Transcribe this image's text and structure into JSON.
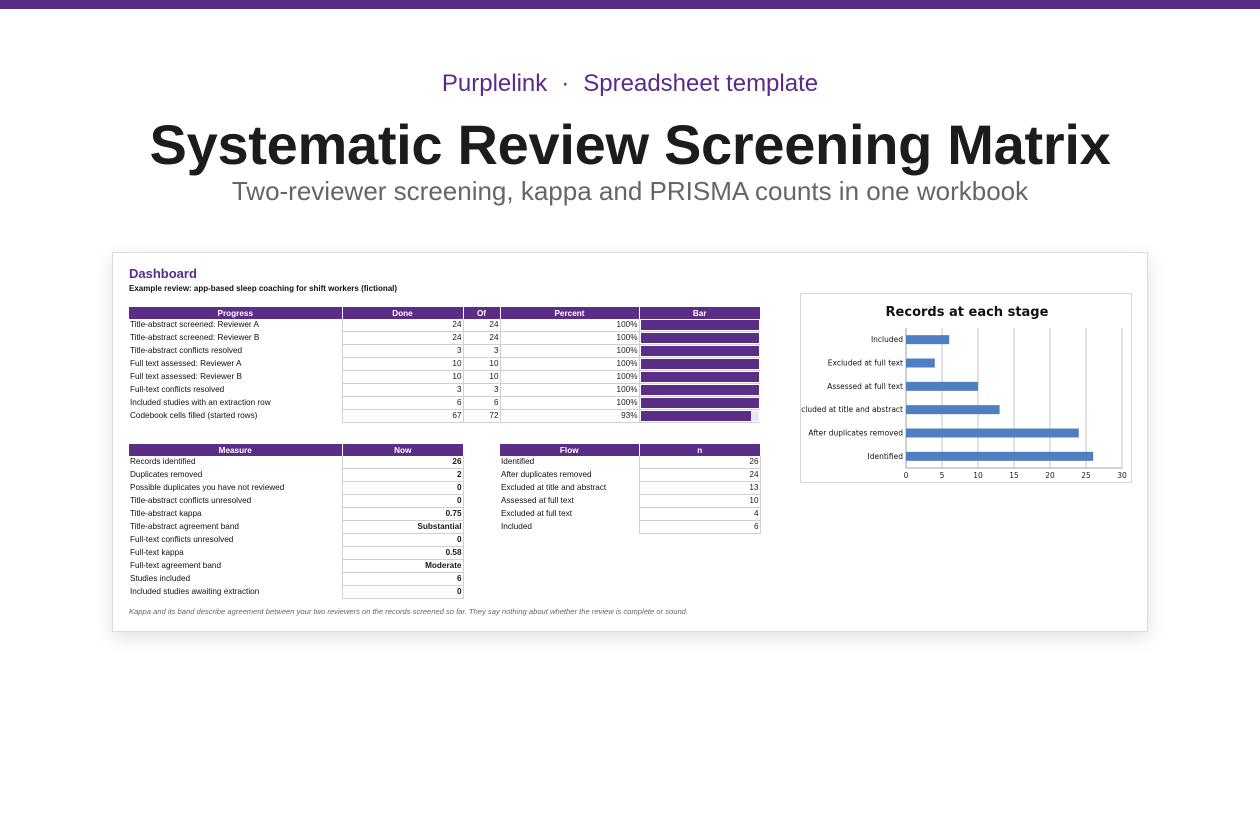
{
  "header": {
    "brand": "Purplelink",
    "separator": "·",
    "tagline": "Spreadsheet template",
    "title": "Systematic Review Screening Matrix",
    "subtitle": "Two-reviewer screening, kappa and PRISMA counts in one workbook"
  },
  "sheet": {
    "title": "Dashboard",
    "subtitle": "Example review: app-based sleep coaching for shift workers (fictional)",
    "footnote": "Kappa and its band describe agreement between your two reviewers on the records screened so far. They say nothing about whether the review is complete or sound."
  },
  "progress": {
    "headers": [
      "Progress",
      "Done",
      "Of",
      "Percent",
      "Bar"
    ],
    "rows": [
      {
        "label": "Title-abstract screened: Reviewer A",
        "done": "24",
        "of": "24",
        "percent": "100%",
        "fraction": 1.0
      },
      {
        "label": "Title-abstract screened: Reviewer B",
        "done": "24",
        "of": "24",
        "percent": "100%",
        "fraction": 1.0
      },
      {
        "label": "Title-abstract conflicts resolved",
        "done": "3",
        "of": "3",
        "percent": "100%",
        "fraction": 1.0
      },
      {
        "label": "Full text assessed: Reviewer A",
        "done": "10",
        "of": "10",
        "percent": "100%",
        "fraction": 1.0
      },
      {
        "label": "Full text assessed: Reviewer B",
        "done": "10",
        "of": "10",
        "percent": "100%",
        "fraction": 1.0
      },
      {
        "label": "Full-text conflicts resolved",
        "done": "3",
        "of": "3",
        "percent": "100%",
        "fraction": 1.0
      },
      {
        "label": "Included studies with an extraction row",
        "done": "6",
        "of": "6",
        "percent": "100%",
        "fraction": 1.0
      },
      {
        "label": "Codebook cells filled (started rows)",
        "done": "67",
        "of": "72",
        "percent": "93%",
        "fraction": 0.93
      }
    ],
    "bar_color": "#5a2d86"
  },
  "measures": {
    "headers": [
      "Measure",
      "Now"
    ],
    "rows": [
      {
        "label": "Records identified",
        "value": "26"
      },
      {
        "label": "Duplicates removed",
        "value": "2"
      },
      {
        "label": "Possible duplicates you have not reviewed",
        "value": "0"
      },
      {
        "label": "Title-abstract conflicts unresolved",
        "value": "0"
      },
      {
        "label": "Title-abstract kappa",
        "value": "0.75"
      },
      {
        "label": "Title-abstract agreement band",
        "value": "Substantial"
      },
      {
        "label": "Full-text conflicts unresolved",
        "value": "0"
      },
      {
        "label": "Full-text kappa",
        "value": "0.58"
      },
      {
        "label": "Full-text agreement band",
        "value": "Moderate"
      },
      {
        "label": "Studies included",
        "value": "6"
      },
      {
        "label": "Included studies awaiting extraction",
        "value": "0"
      }
    ]
  },
  "flow": {
    "headers": [
      "Flow",
      "n"
    ],
    "rows": [
      {
        "label": "Identified",
        "value": "26"
      },
      {
        "label": "After duplicates removed",
        "value": "24"
      },
      {
        "label": "Excluded at title and abstract",
        "value": "13"
      },
      {
        "label": "Assessed at full text",
        "value": "10"
      },
      {
        "label": "Excluded at full text",
        "value": "4"
      },
      {
        "label": "Included",
        "value": "6"
      }
    ]
  },
  "chart_data": {
    "type": "bar",
    "orientation": "horizontal",
    "title": "Records at each stage",
    "categories": [
      "Included",
      "Excluded at full text",
      "Assessed at full text",
      "Excluded at title and abstract",
      "After duplicates removed",
      "Identified"
    ],
    "values": [
      6,
      4,
      10,
      13,
      24,
      26
    ],
    "xlim": [
      0,
      30
    ],
    "xticks": [
      0,
      5,
      10,
      15,
      20,
      25,
      30
    ],
    "grid": true,
    "color": "#4f7fc0"
  },
  "colors": {
    "accent": "#5a2d86",
    "bar_series": "#4f7fc0"
  }
}
